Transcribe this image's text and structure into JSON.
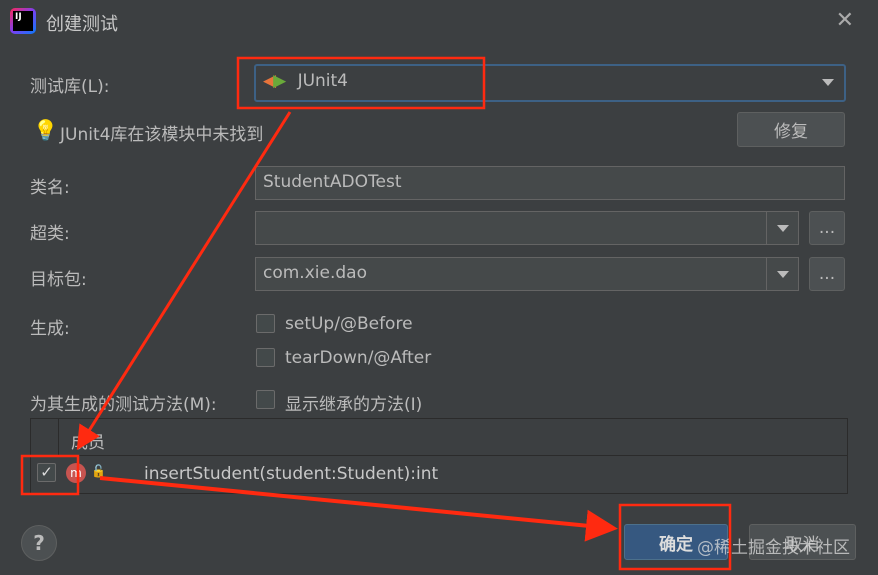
{
  "dialog": {
    "title": "创建测试",
    "close_icon": "close-icon"
  },
  "library": {
    "label": "测试库(L):",
    "value": "JUnit4"
  },
  "warning": {
    "text": "JUnit4库在该模块中未找到",
    "fix_button": "修复"
  },
  "class_name": {
    "label": "类名:",
    "value": "StudentADOTest"
  },
  "superclass": {
    "label": "超类:",
    "value": "",
    "browse": "..."
  },
  "package": {
    "label": "目标包:",
    "value": "com.xie.dao",
    "browse": "..."
  },
  "generate": {
    "label": "生成:",
    "options": [
      {
        "label": "setUp/@Before",
        "checked": false
      },
      {
        "label": "tearDown/@After",
        "checked": false
      }
    ]
  },
  "methods": {
    "label": "为其生成的测试方法(M):",
    "show_inherited": "显示继承的方法(I)",
    "column": "成员",
    "rows": [
      {
        "checked": true,
        "name": "insertStudent(student:Student):int"
      }
    ]
  },
  "footer": {
    "help": "?",
    "ok": "确定",
    "cancel": "取消",
    "watermark": "@稀土掘金技术社区"
  },
  "colors": {
    "annotation": "#ff2a10",
    "accent": "#365880"
  }
}
